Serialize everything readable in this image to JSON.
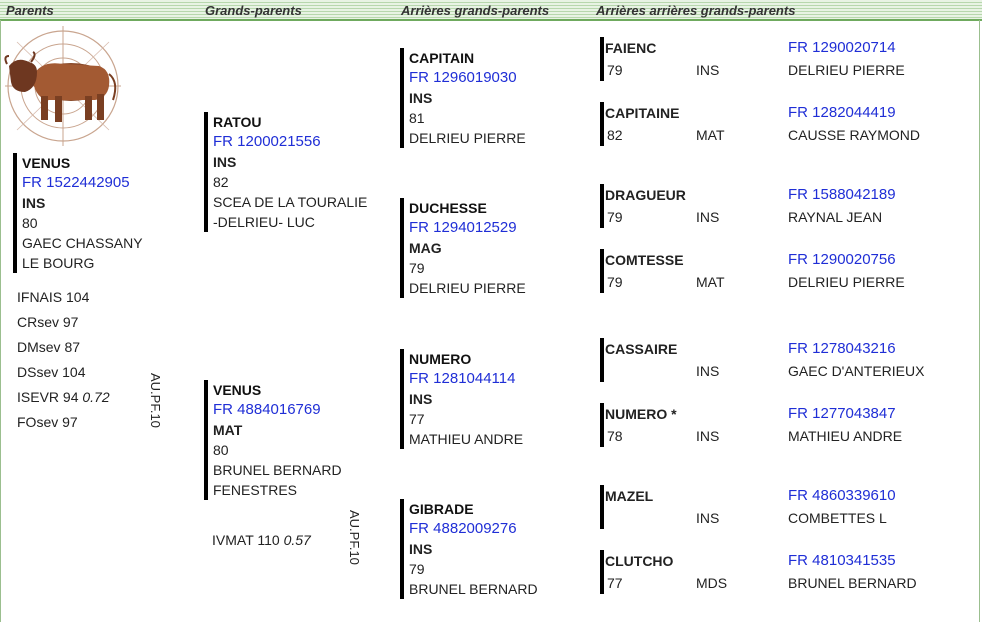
{
  "headers": {
    "parents": "Parents",
    "grands_parents": "Grands-parents",
    "arrieres": "Arrières grands-parents",
    "arrieres_arrieres": "Arrières arrières grands-parents"
  },
  "animal": {
    "name": "VENUS",
    "reg": "FR 1522442905",
    "race": "INS",
    "year": "80",
    "owner1": "GAEC CHASSANY",
    "owner2": "LE BOURG"
  },
  "indices": [
    "IFNAIS 104",
    "CRsev 97",
    "DMsev 87",
    "DSsev 104"
  ],
  "isevr": {
    "label": "ISEVR 94",
    "value": "0.72"
  },
  "fosev": "FOsev 97",
  "aupf_1": "AU.PF.10",
  "aupf_2": "AU.PF.10",
  "grand_parents": [
    {
      "name": "RATOU",
      "reg": "FR 1200021556",
      "race": "INS",
      "year": "82",
      "owner1": "SCEA DE LA TOURALIE",
      "owner2": "-DELRIEU- LUC"
    },
    {
      "name": "VENUS",
      "reg": "FR 4884016769",
      "race": "MAT",
      "year": "80",
      "owner1": "BRUNEL BERNARD",
      "owner2": "FENESTRES"
    }
  ],
  "ivmat": {
    "label": "IVMAT 110",
    "value": "0.57"
  },
  "great_grand_parents": [
    {
      "name": "CAPITAIN",
      "reg": "FR 1296019030",
      "race": "INS",
      "year": "81",
      "owner": "DELRIEU PIERRE"
    },
    {
      "name": "DUCHESSE",
      "reg": "FR 1294012529",
      "race": "MAG",
      "year": "79",
      "owner": "DELRIEU PIERRE"
    },
    {
      "name": "NUMERO",
      "reg": "FR 1281044114",
      "race": "INS",
      "year": "77",
      "owner": "MATHIEU ANDRE"
    },
    {
      "name": "GIBRADE",
      "reg": "FR 4882009276",
      "race": "INS",
      "year": "79",
      "owner": "BRUNEL BERNARD"
    }
  ],
  "great_great": [
    {
      "name": "FAIENC",
      "year": "79",
      "race": "INS",
      "reg": "FR 1290020714",
      "owner": "DELRIEU PIERRE"
    },
    {
      "name": "CAPITAINE",
      "year": "82",
      "race": "MAT",
      "reg": "FR 1282044419",
      "owner": "CAUSSE RAYMOND"
    },
    {
      "name": "DRAGUEUR",
      "year": "79",
      "race": "INS",
      "reg": "FR 1588042189",
      "owner": "RAYNAL JEAN"
    },
    {
      "name": "COMTESSE",
      "year": "79",
      "race": "MAT",
      "reg": "FR 1290020756",
      "owner": "DELRIEU PIERRE"
    },
    {
      "name": "CASSAIRE",
      "year": "",
      "race": "INS",
      "reg": "FR 1278043216",
      "owner": "GAEC D'ANTERIEUX"
    },
    {
      "name": "NUMERO *",
      "year": "78",
      "race": "INS",
      "reg": "FR 1277043847",
      "owner": "MATHIEU ANDRE"
    },
    {
      "name": "MAZEL",
      "year": "",
      "race": "INS",
      "reg": "FR 4860339610",
      "owner": "COMBETTES L"
    },
    {
      "name": "CLUTCHO",
      "year": "77",
      "race": "MDS",
      "reg": "FR 4810341535",
      "owner": "BRUNEL BERNARD"
    }
  ],
  "colors": {
    "header_green": "#6faa5e",
    "reg_blue": "#1f2ed6",
    "bull_brown": "#8a4a2a"
  },
  "icons": {
    "logo": "bull-target-logo"
  }
}
